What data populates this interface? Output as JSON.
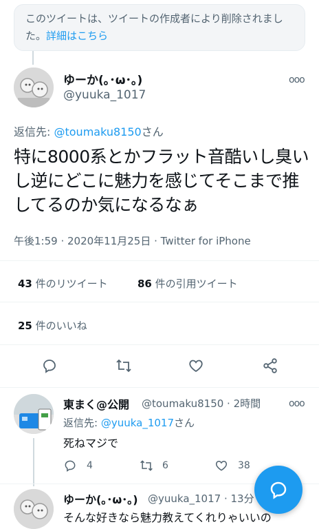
{
  "deleted_notice": {
    "text": "このツイートは、ツイートの作成者により削除されました。",
    "link": "詳細はこちら"
  },
  "main_tweet": {
    "display_name": "ゆーか(｡･ω･｡)",
    "handle": "@yuuka_1017",
    "reply_prefix": "返信先: ",
    "reply_to": "@toumaku8150",
    "reply_suffix": "さん",
    "text": "特に8000系とかフラット音酷いし臭いし逆にどこに魅力を感じてそこまで推してるのか気になるなぁ",
    "meta": "午後1:59 · 2020年11月25日 · Twitter for iPhone",
    "retweets_count": "43",
    "retweets_label": " 件のリツイート",
    "quotes_count": "86",
    "quotes_label": " 件の引用ツイート",
    "likes_count": "25",
    "likes_label": " 件のいいね"
  },
  "reply_tweet": {
    "display_name": "東まく@公開",
    "handle": "@toumaku8150 · 2時間",
    "reply_prefix": "返信先: ",
    "reply_to": "@yuuka_1017",
    "reply_suffix": "さん",
    "text": "死ねマジで",
    "reply_count": "4",
    "retweet_count": "6",
    "like_count": "38"
  },
  "next_tweet": {
    "display_name": "ゆーか(｡･ω･｡)",
    "handle": "@yuuka_1017 · 13分",
    "text": "そんな好きなら魅力教えてくれりゃいいの"
  },
  "more_glyph": "ooo",
  "colors": {
    "accent": "#1d9bf0",
    "muted": "#536471",
    "text": "#0f1419"
  }
}
